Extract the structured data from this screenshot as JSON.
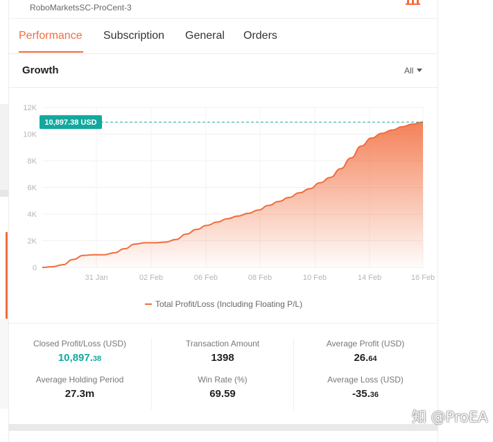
{
  "account": {
    "name": "RoboMarketsSC-ProCent-3"
  },
  "tabs": [
    {
      "label": "Performance",
      "active": true
    },
    {
      "label": "Subscription",
      "active": false
    },
    {
      "label": "General",
      "active": false
    },
    {
      "label": "Orders",
      "active": false
    }
  ],
  "growth": {
    "title": "Growth",
    "range": "All"
  },
  "colors": {
    "accent": "#f26b3a",
    "positive": "#13a89e",
    "badge": "#13a89e"
  },
  "chart_data": {
    "type": "area",
    "ylim": [
      0,
      12000
    ],
    "yticks": [
      0,
      2000,
      4000,
      6000,
      8000,
      10000,
      12000
    ],
    "ytick_labels": [
      "0",
      "2K",
      "4K",
      "6K",
      "8K",
      "10K",
      "12K"
    ],
    "xtick_labels": [
      "31 Jan",
      "02 Feb",
      "06 Feb",
      "08 Feb",
      "10 Feb",
      "14 Feb",
      "16 Feb"
    ],
    "grid": true,
    "current_value_label": "10,897.38 USD",
    "current_value": 10897.38,
    "series": [
      {
        "name": "Total Profit/Loss (Including Floating P/L)",
        "values": [
          0,
          50,
          200,
          600,
          900,
          950,
          950,
          1100,
          1400,
          1750,
          1850,
          1850,
          1900,
          2100,
          2500,
          2850,
          3150,
          3400,
          3650,
          3850,
          4050,
          4300,
          4650,
          4950,
          5250,
          5600,
          5900,
          6350,
          6750,
          7400,
          8200,
          9100,
          9700,
          10050,
          10300,
          10550,
          10750,
          10897
        ]
      }
    ],
    "legend_position": "bottom"
  },
  "stats": {
    "closed_pl_label": "Closed Profit/Loss (USD)",
    "closed_pl_int": "10,897.",
    "closed_pl_dec": "38",
    "transaction_label": "Transaction Amount",
    "transaction_value": "1398",
    "avg_profit_label": "Average Profit (USD)",
    "avg_profit_int": "26.",
    "avg_profit_dec": "64",
    "holding_label": "Average Holding Period",
    "holding_value": "27.3m",
    "winrate_label": "Win Rate (%)",
    "winrate_value": "69.59",
    "avg_loss_label": "Average Loss (USD)",
    "avg_loss_int": "-35.",
    "avg_loss_dec": "36"
  },
  "watermark": {
    "text": "知 @ProEA"
  },
  "icons": {
    "top_right": "chart-bar-icon",
    "range_caret": "chevron-down-icon"
  }
}
